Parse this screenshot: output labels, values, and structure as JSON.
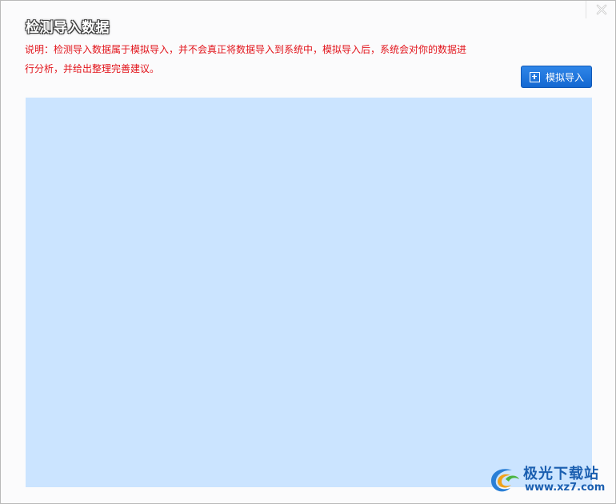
{
  "dialog": {
    "title": "检测导入数据",
    "description": "说明：检测导入数据属于模拟导入，并不会真正将数据导入到系统中，模拟导入后，系统会对你的数据进行分析，并给出整理完善建议。",
    "simulate_import_label": "模拟导入",
    "close_icon": "close-icon",
    "button_icon": "plus-box-icon"
  },
  "watermark": {
    "name": "极光下载站",
    "url": "www.xz7.com"
  },
  "colors": {
    "accent": "#1a73dc",
    "description_text": "#e2141b",
    "panel_background": "#cbe4ff",
    "window_background": "#fbfbfc"
  }
}
